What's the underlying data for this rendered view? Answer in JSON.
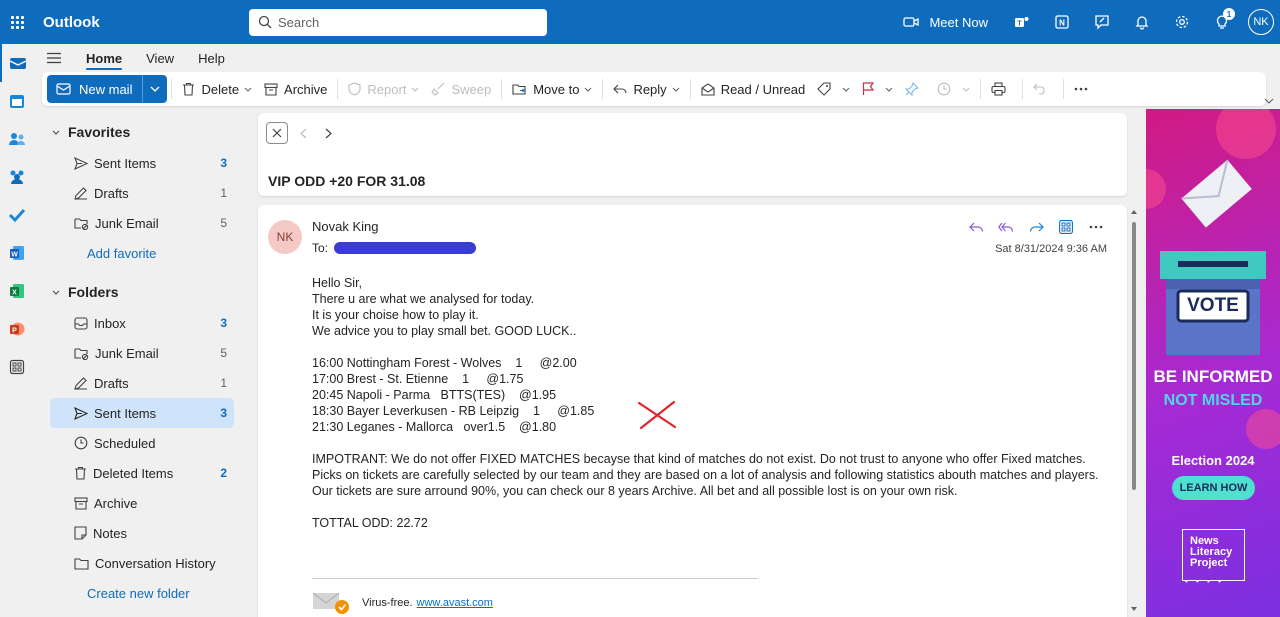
{
  "topbar": {
    "app_name": "Outlook",
    "search_placeholder": "Search",
    "meet_now": "Meet Now",
    "tips_badge": "1",
    "avatar": "NK",
    "color": "#0f6cbd"
  },
  "ribbon": {
    "tabs": [
      "Home",
      "View",
      "Help"
    ],
    "new_mail": "New mail",
    "delete": "Delete",
    "archive": "Archive",
    "report": "Report",
    "sweep": "Sweep",
    "move_to": "Move to",
    "reply": "Reply",
    "read_unread": "Read / Unread"
  },
  "folders": {
    "favorites_title": "Favorites",
    "favorites": [
      {
        "label": "Sent Items",
        "count": "3"
      },
      {
        "label": "Drafts",
        "count": "1"
      },
      {
        "label": "Junk Email",
        "count": "5"
      }
    ],
    "add_favorite": "Add favorite",
    "folders_title": "Folders",
    "items": [
      {
        "label": "Inbox",
        "count": "3"
      },
      {
        "label": "Junk Email",
        "count": "5"
      },
      {
        "label": "Drafts",
        "count": "1"
      },
      {
        "label": "Sent Items",
        "count": "3"
      },
      {
        "label": "Scheduled",
        "count": ""
      },
      {
        "label": "Deleted Items",
        "count": "2"
      },
      {
        "label": "Archive",
        "count": ""
      },
      {
        "label": "Notes",
        "count": ""
      },
      {
        "label": "Conversation History",
        "count": ""
      }
    ],
    "create_folder": "Create new folder"
  },
  "message": {
    "subject": "VIP ODD +20 FOR 31.08",
    "sender_initials": "NK",
    "sender_name": "Novak King",
    "to_label": "To:",
    "date": "Sat 8/31/2024 9:36 AM",
    "body": [
      "Hello Sir,",
      "There u are what we analysed for today.",
      "It is your choise how to play it.",
      "We advice you to play small bet. GOOD LUCK..",
      "",
      "16:00 Nottingham Forest - Wolves    1     @2.00",
      "17:00 Brest - St. Etienne    1     @1.75",
      "20:45 Napoli - Parma   BTTS(TES)    @1.95",
      "18:30 Bayer Leverkusen - RB Leipzig    1     @1.85",
      "21:30 Leganes - Mallorca   over1.5    @1.80",
      "",
      "IMPOTRANT: We do not offer FIXED MATCHES becayse that kind of matches do not exist. Do not trust to anyone who offer Fixed matches. Picks on tickets are carefully selected by our team and they are based on a lot of analysis and following statistics abouth matches and players. Our tickets are sure arround 90%, you can check our 8 years Archive. All bet and all possible lost is on your own risk.",
      "",
      "TOTTAL ODD: 22.72"
    ],
    "virus_free": "Virus-free.",
    "avast_link": "www.avast.com"
  },
  "ad": {
    "vote": "VOTE",
    "line1": "BE INFORMED",
    "line2": "NOT MISLED",
    "election": "Election 2024",
    "cta": "LEARN HOW",
    "logo_line1": "News",
    "logo_line2": "Literacy",
    "logo_line3": "Project"
  }
}
